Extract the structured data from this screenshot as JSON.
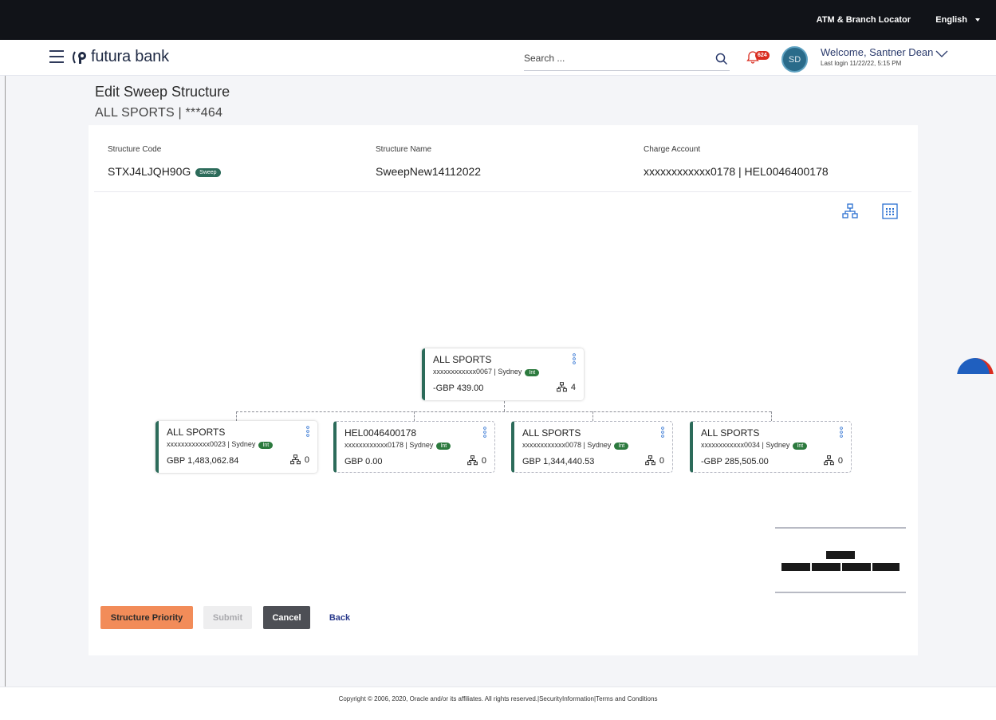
{
  "topbar": {
    "locator": "ATM & Branch Locator",
    "language": "English"
  },
  "header": {
    "brand": "futura bank",
    "search_placeholder": "Search ...",
    "notification_count": "624",
    "avatar_initials": "SD",
    "welcome": "Welcome, Santner Dean",
    "last_login": "Last login 11/22/22, 5:15 PM"
  },
  "page": {
    "title": "Edit Sweep Structure",
    "subtitle": "ALL SPORTS | ***464"
  },
  "info": {
    "structure_code_label": "Structure Code",
    "structure_code": "STXJ4LJQH90G",
    "structure_code_tag": "Sweep",
    "structure_name_label": "Structure Name",
    "structure_name": "SweepNew14112022",
    "charge_account_label": "Charge Account",
    "charge_account": "xxxxxxxxxxxx0178 | HEL0046400178"
  },
  "tree": {
    "root": {
      "title": "ALL SPORTS",
      "account": "xxxxxxxxxxxx0067 | Sydney",
      "tag": "Int",
      "balance": "-GBP 439.00",
      "children_count": "4"
    },
    "children": [
      {
        "title": "ALL SPORTS",
        "account": "xxxxxxxxxxxx0023 | Sydney",
        "tag": "Int",
        "balance": "GBP 1,483,062.84",
        "children_count": "0"
      },
      {
        "title": "HEL0046400178",
        "account": "xxxxxxxxxxxx0178 | Sydney",
        "tag": "Int",
        "balance": "GBP 0.00",
        "children_count": "0"
      },
      {
        "title": "ALL SPORTS",
        "account": "xxxxxxxxxxxx0078 | Sydney",
        "tag": "Int",
        "balance": "GBP 1,344,440.53",
        "children_count": "0"
      },
      {
        "title": "ALL SPORTS",
        "account": "xxxxxxxxxxxx0034 | Sydney",
        "tag": "Int",
        "balance": "-GBP 285,505.00",
        "children_count": "0"
      }
    ]
  },
  "buttons": {
    "priority": "Structure Priority",
    "submit": "Submit",
    "cancel": "Cancel",
    "back": "Back"
  },
  "footer": {
    "text": "Copyright © 2006, 2020, Oracle and/or its affiliates. All rights reserved.|SecurityInformation|Terms and Conditions"
  },
  "colors": {
    "accent": "#2c6b5a",
    "primary_button": "#f28c59",
    "dark_button": "#4d4f55",
    "int_tag": "#2c7a3e"
  }
}
